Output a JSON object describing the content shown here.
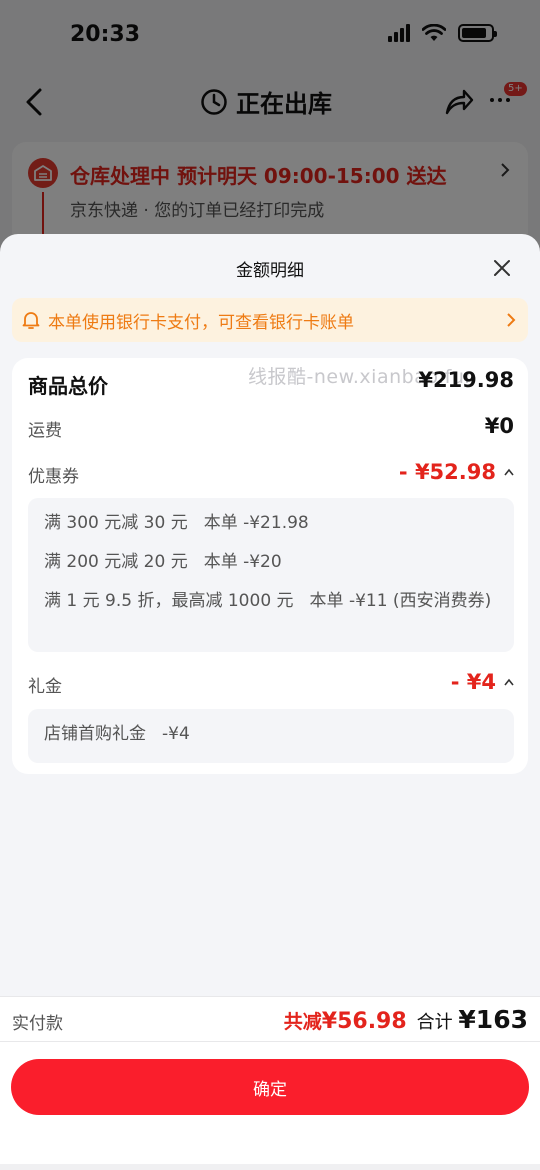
{
  "status_bar": {
    "time": "20:33"
  },
  "nav": {
    "title": "正在出库",
    "badge": "5+"
  },
  "order": {
    "status": "仓库处理中 预计明天 09:00-15:00 送达",
    "sub": "京东快递 · 您的订单已经打印完成"
  },
  "sheet": {
    "title": "金额明细",
    "notice": "本单使用银行卡支付，可查看银行卡账单",
    "watermark": "线报酷-new.xianbao.fun",
    "goods_total": {
      "label": "商品总价",
      "value": "¥219.98"
    },
    "shipping": {
      "label": "运费",
      "value": "¥0"
    },
    "coupons": {
      "label": "优惠券",
      "value": "- ¥52.98",
      "items": [
        {
          "rule": "满 300 元减 30 元",
          "amount": "本单 -¥21.98"
        },
        {
          "rule": "满 200 元减 20 元",
          "amount": "本单 -¥20"
        },
        {
          "rule": "满 1 元 9.5 折，最高减 1000 元",
          "amount": "本单 -¥11 (西安消费券)"
        }
      ]
    },
    "gift": {
      "label": "礼金",
      "value": "- ¥4",
      "items": [
        {
          "rule": "店铺首购礼金",
          "amount": "-¥4"
        }
      ]
    }
  },
  "footer": {
    "pay_label": "实付款",
    "reduce_prefix": "共减",
    "reduce_value": "¥56.98",
    "sum_prefix": "合计",
    "sum_value": "¥163",
    "confirm": "确定"
  },
  "colors": {
    "accent_red": "#fa1e2c",
    "price_red": "#e3241c",
    "notice_orange": "#ee7b13"
  }
}
